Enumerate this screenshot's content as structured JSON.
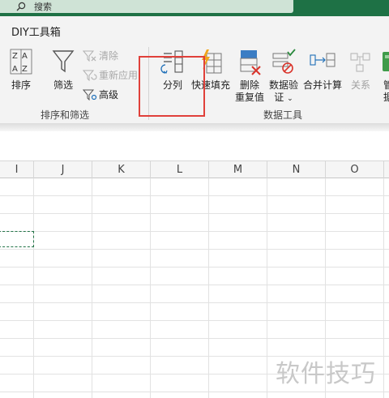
{
  "search": {
    "label": "搜索"
  },
  "ribbon": {
    "tab": "DIY工具箱",
    "groups": {
      "sort_filter": {
        "label": "排序和筛选",
        "sort": "排序",
        "filter": "筛选",
        "clear": "清除",
        "reapply": "重新应用",
        "advanced": "高级"
      },
      "data_tools": {
        "label": "数据工具",
        "text_to_columns": "分列",
        "flash_fill": "快速填充",
        "remove_duplicates_1": "删除",
        "remove_duplicates_2": "重复值",
        "data_validation_1": "数据验",
        "data_validation_2": "证",
        "consolidate": "合并计算",
        "relationships": "关系",
        "manage_1": "管",
        "manage_2": "据"
      }
    }
  },
  "sheet": {
    "columns": [
      "I",
      "J",
      "K",
      "L",
      "M",
      "N",
      "O"
    ]
  },
  "watermark": "软件技巧",
  "colors": {
    "accent": "#1e7145",
    "highlight": "#e0403a",
    "selection": "#217346"
  }
}
